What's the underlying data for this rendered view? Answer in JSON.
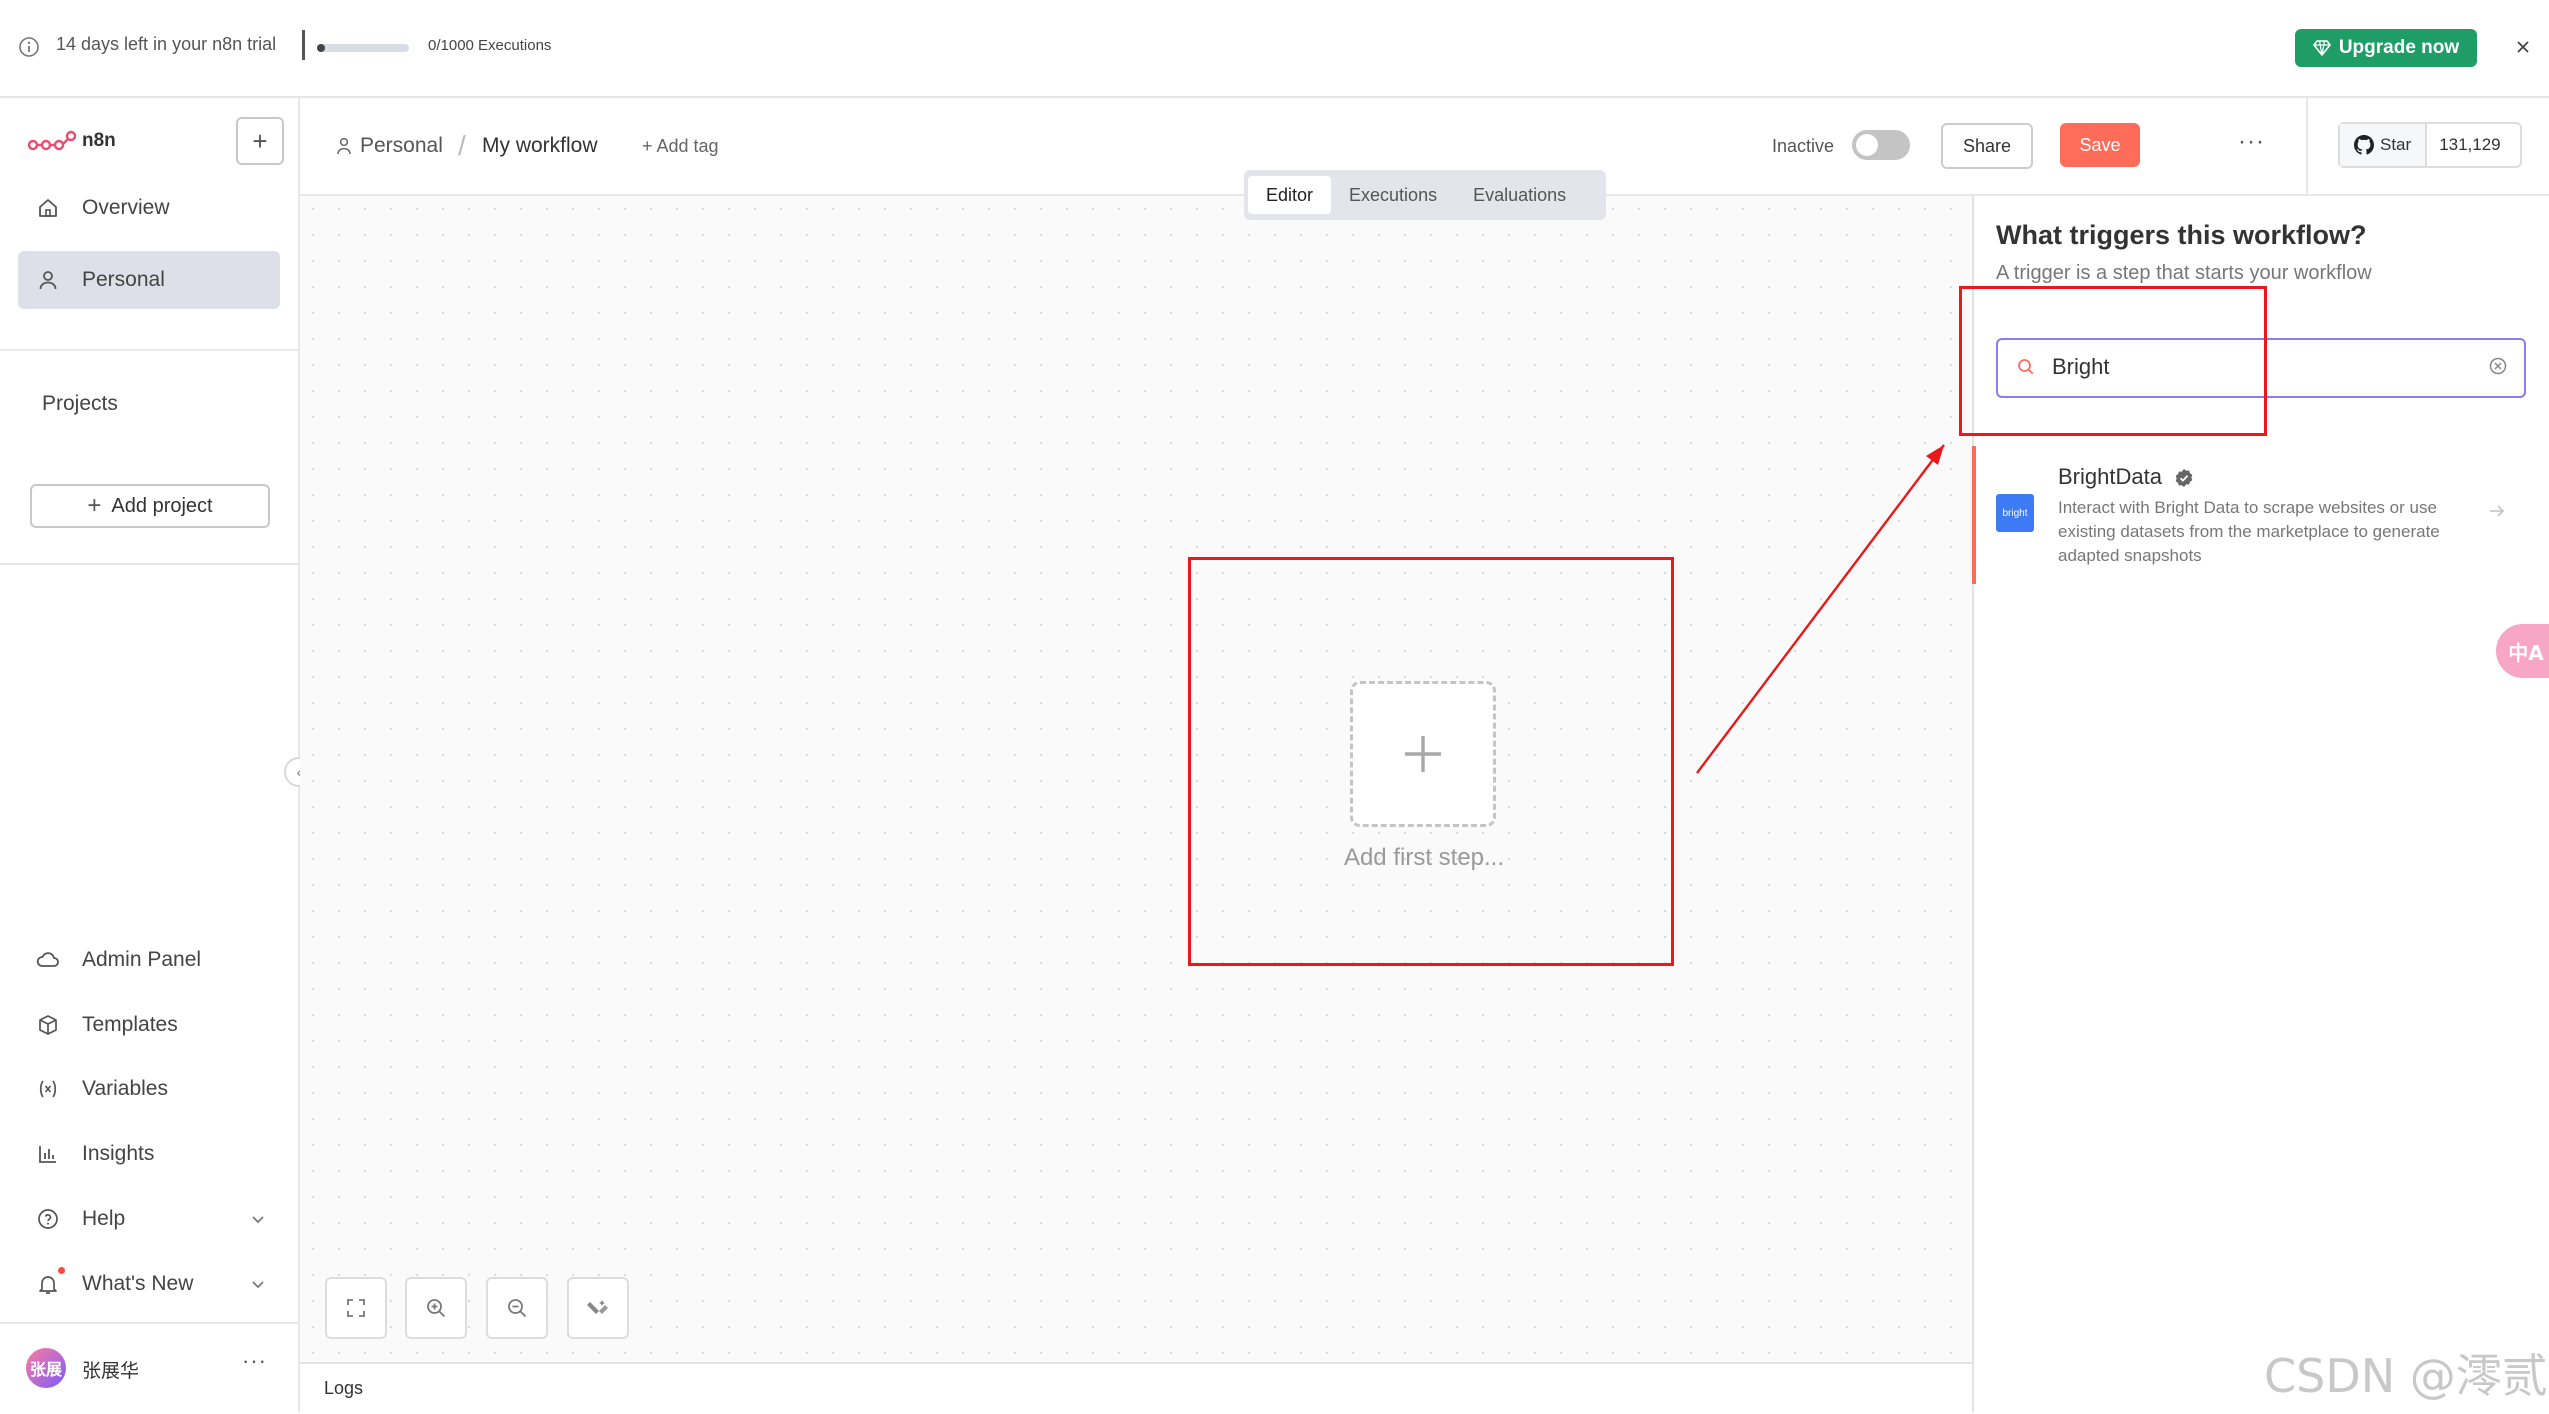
{
  "banner": {
    "trial_text": "14 days left in your n8n trial",
    "executions_text": "0/1000 Executions",
    "executions_used": 0,
    "executions_limit": 1000,
    "upgrade_label": "Upgrade now"
  },
  "sidebar": {
    "logo_text": "n8n",
    "new_button": "+",
    "nav": [
      {
        "label": "Overview",
        "icon": "home-icon"
      },
      {
        "label": "Personal",
        "icon": "user-icon",
        "active": true
      }
    ],
    "projects_label": "Projects",
    "add_project_label": "Add project",
    "bottom_nav": [
      {
        "label": "Admin Panel",
        "icon": "cloud-icon"
      },
      {
        "label": "Templates",
        "icon": "box-icon"
      },
      {
        "label": "Variables",
        "icon": "variable-icon"
      },
      {
        "label": "Insights",
        "icon": "chart-icon"
      },
      {
        "label": "Help",
        "icon": "help-icon"
      },
      {
        "label": "What's New",
        "icon": "bell-icon"
      }
    ],
    "user_name": "张展华",
    "user_initials": "张展",
    "user_more": "···"
  },
  "header": {
    "breadcrumb_project": "Personal",
    "breadcrumb_separator": "/",
    "workflow_name": "My workflow",
    "add_tag": "+ Add tag",
    "active_label": "Inactive",
    "active": false,
    "share_label": "Share",
    "save_label": "Save",
    "more_label": "···",
    "github_star_label": "Star",
    "github_star_count": "131,129"
  },
  "tabs": [
    {
      "label": "Editor",
      "active": true
    },
    {
      "label": "Executions"
    },
    {
      "label": "Evaluations"
    }
  ],
  "canvas": {
    "add_first_step_label": "Add first step...",
    "controls": [
      "fit-view-icon",
      "zoom-in-icon",
      "zoom-out-icon",
      "tidy-up-icon"
    ]
  },
  "logs": {
    "label": "Logs"
  },
  "node_creator": {
    "title": "What triggers this workflow?",
    "subtitle": "A trigger is a step that starts your workflow",
    "search_value": "Bright",
    "results": [
      {
        "name": "BrightData",
        "logo_text": "bright",
        "description": "Interact with Bright Data to scrape websites or use existing datasets from the marketplace to generate adapted snapshots"
      }
    ]
  },
  "translate_label": "中A",
  "watermark": "CSDN @澪贰",
  "colors": {
    "brand": "#ff6d5a",
    "upgrade": "#1e9e66",
    "annotation": "#e8191b",
    "search_border": "#8a7cf0"
  }
}
